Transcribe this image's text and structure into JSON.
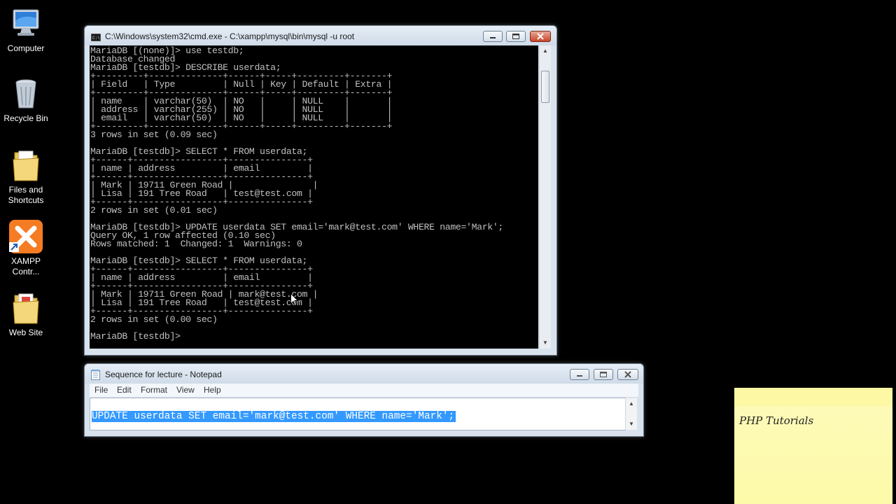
{
  "desktop": {
    "icons": [
      {
        "label_line1": "Computer",
        "label_line2": "",
        "icon": "computer-icon"
      },
      {
        "label_line1": "Recycle Bin",
        "label_line2": "",
        "icon": "recycle-bin-icon"
      },
      {
        "label_line1": "Files and",
        "label_line2": "Shortcuts",
        "icon": "folder-icon"
      },
      {
        "label_line1": "XAMPP",
        "label_line2": "Contr...",
        "icon": "xampp-icon"
      },
      {
        "label_line1": "Web Site",
        "label_line2": "",
        "icon": "folder-icon"
      }
    ]
  },
  "cmd": {
    "title": "C:\\Windows\\system32\\cmd.exe - C:\\xampp\\mysql\\bin\\mysql  -u root",
    "lines": [
      "MariaDB [(none)]> use testdb;",
      "Database changed",
      "MariaDB [testdb]> DESCRIBE userdata;",
      "+---------+--------------+------+-----+---------+-------+",
      "| Field   | Type         | Null | Key | Default | Extra |",
      "+---------+--------------+------+-----+---------+-------+",
      "| name    | varchar(50)  | NO   |     | NULL    |       |",
      "| address | varchar(255) | NO   |     | NULL    |       |",
      "| email   | varchar(50)  | NO   |     | NULL    |       |",
      "+---------+--------------+------+-----+---------+-------+",
      "3 rows in set (0.09 sec)",
      "",
      "MariaDB [testdb]> SELECT * FROM userdata;",
      "+------+-----------------+---------------+",
      "| name | address         | email         |",
      "+------+-----------------+---------------+",
      "| Mark | 19711 Green Road |               |",
      "| Lisa | 191 Tree Road   | test@test.com |",
      "+------+-----------------+---------------+",
      "2 rows in set (0.01 sec)",
      "",
      "MariaDB [testdb]> UPDATE userdata SET email='mark@test.com' WHERE name='Mark';",
      "Query OK, 1 row affected (0.10 sec)",
      "Rows matched: 1  Changed: 1  Warnings: 0",
      "",
      "MariaDB [testdb]> SELECT * FROM userdata;",
      "+------+-----------------+---------------+",
      "| name | address         | email         |",
      "+------+-----------------+---------------+",
      "| Mark | 19711 Green Road | mark@test.com |",
      "| Lisa | 191 Tree Road   | test@test.com |",
      "+------+-----------------+---------------+",
      "2 rows in set (0.00 sec)",
      "",
      "MariaDB [testdb]>"
    ],
    "colors": {
      "text": "#c0c0c0",
      "background": "#000000"
    }
  },
  "notepad": {
    "title": "Sequence for lecture - Notepad",
    "menu": [
      "File",
      "Edit",
      "Format",
      "View",
      "Help"
    ],
    "content": "UPDATE userdata SET email='mark@test.com' WHERE name='Mark';",
    "selection_color": "#3399ff"
  },
  "sticky_note": {
    "text": "PHP Tutorials"
  }
}
